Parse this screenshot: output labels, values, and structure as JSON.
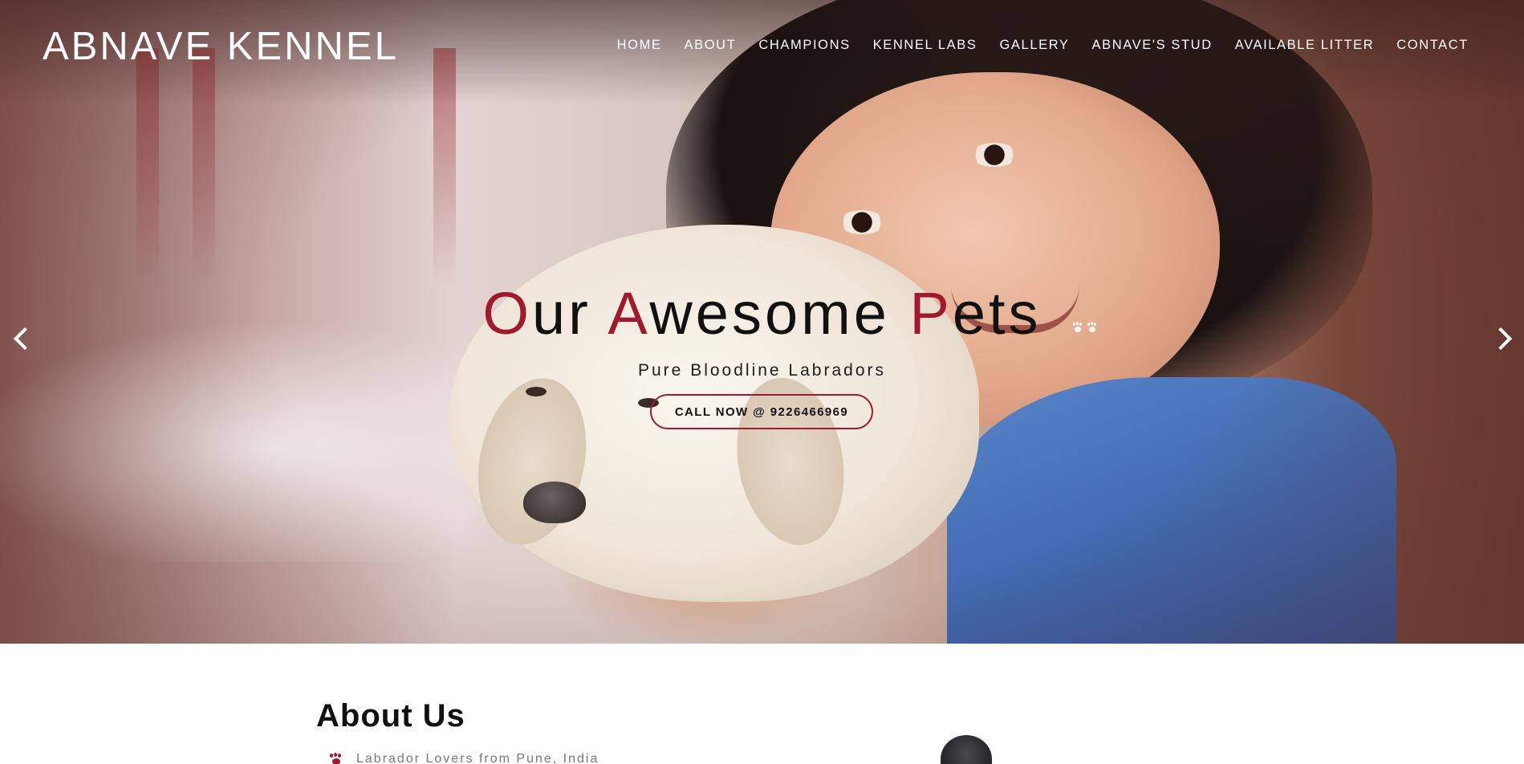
{
  "brand": {
    "name": "ABNAVE KENNEL"
  },
  "nav": {
    "items": [
      {
        "label": "HOME"
      },
      {
        "label": "ABOUT"
      },
      {
        "label": "CHAMPIONS"
      },
      {
        "label": "KENNEL LABS"
      },
      {
        "label": "GALLERY"
      },
      {
        "label": "ABNAVE'S STUD"
      },
      {
        "label": "AVAILABLE LITTER"
      },
      {
        "label": "CONTACT"
      }
    ]
  },
  "hero": {
    "headline": [
      {
        "cap": "O",
        "rest": "ur "
      },
      {
        "cap": "A",
        "rest": "wesome "
      },
      {
        "cap": "P",
        "rest": "ets"
      }
    ],
    "subtitle": "Pure Bloodline Labradors",
    "cta_label": "CALL NOW @ 9226466969",
    "accent_color": "#9e1a2c",
    "paw_icon": "paw-prints-icon",
    "prev_icon": "chevron-left-icon",
    "next_icon": "chevron-right-icon"
  },
  "about": {
    "title": "About Us",
    "tagline": "Labrador Lovers from Pune, India",
    "tagline_icon": "paw-icon"
  }
}
